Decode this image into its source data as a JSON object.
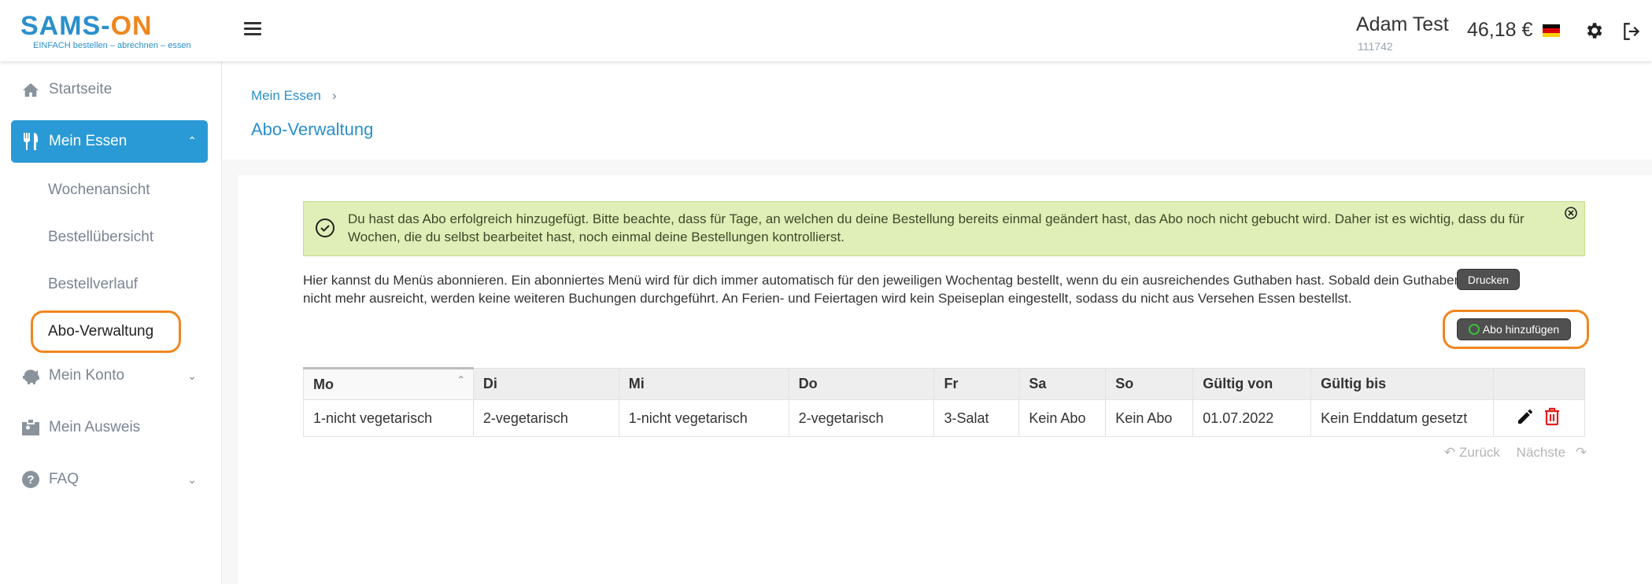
{
  "header": {
    "logo_word_left": "SAMS-",
    "logo_word_right": "ON",
    "logo_tagline": "EINFACH bestellen – abrechnen – essen",
    "user_name": "Adam Test",
    "user_id": "111742",
    "balance": "46,18 €"
  },
  "sidebar": {
    "items": [
      {
        "label": "Startseite",
        "icon": "home-icon"
      },
      {
        "label": "Mein Essen",
        "icon": "cutlery-icon"
      },
      {
        "label": "Mein Konto",
        "icon": "piggy-bank-icon"
      },
      {
        "label": "Mein Ausweis",
        "icon": "id-card-icon"
      },
      {
        "label": "FAQ",
        "icon": "question-icon"
      }
    ],
    "sub_items": [
      "Wochenansicht",
      "Bestellübersicht",
      "Bestellverlauf",
      "Abo-Verwaltung"
    ]
  },
  "breadcrumb": {
    "parent": "Mein Essen"
  },
  "page_title": "Abo-Verwaltung",
  "alert": {
    "text": "Du hast das Abo erfolgreich hinzugefügt. Bitte beachte, dass für Tage, an welchen du deine Bestellung bereits einmal geändert hast, das Abo noch nicht gebucht wird. Daher ist es wichtig, dass du für Wochen, die du selbst bearbeitet hast, noch einmal deine Bestellungen kontrollierst."
  },
  "intro": "Hier kannst du Menüs abonnieren. Ein abonniertes Menü wird für dich immer automatisch für den jeweiligen Wochentag bestellt, wenn du ein ausreichendes Guthaben hast. Sobald dein Guthaben nicht mehr ausreicht, werden keine weiteren Buchungen durchgeführt. An Ferien- und Feiertagen wird kein Speiseplan eingestellt, sodass du nicht aus Versehen Essen bestellst.",
  "buttons": {
    "print": "Drucken",
    "add": "Abo hinzufügen"
  },
  "table": {
    "headers": [
      "Mo",
      "Di",
      "Mi",
      "Do",
      "Fr",
      "Sa",
      "So",
      "Gültig von",
      "Gültig bis",
      ""
    ],
    "rows": [
      [
        "1-nicht vegetarisch",
        "2-vegetarisch",
        "1-nicht vegetarisch",
        "2-vegetarisch",
        "3-Salat",
        "Kein Abo",
        "Kein Abo",
        "01.07.2022",
        "Kein Enddatum gesetzt"
      ]
    ]
  },
  "pager": {
    "prev": "Zurück",
    "next": "Nächste"
  },
  "colors": {
    "accent": "#2a9ad6",
    "highlight": "#f0861f",
    "alert_bg": "#e0eeb7",
    "delete": "#e02020"
  }
}
